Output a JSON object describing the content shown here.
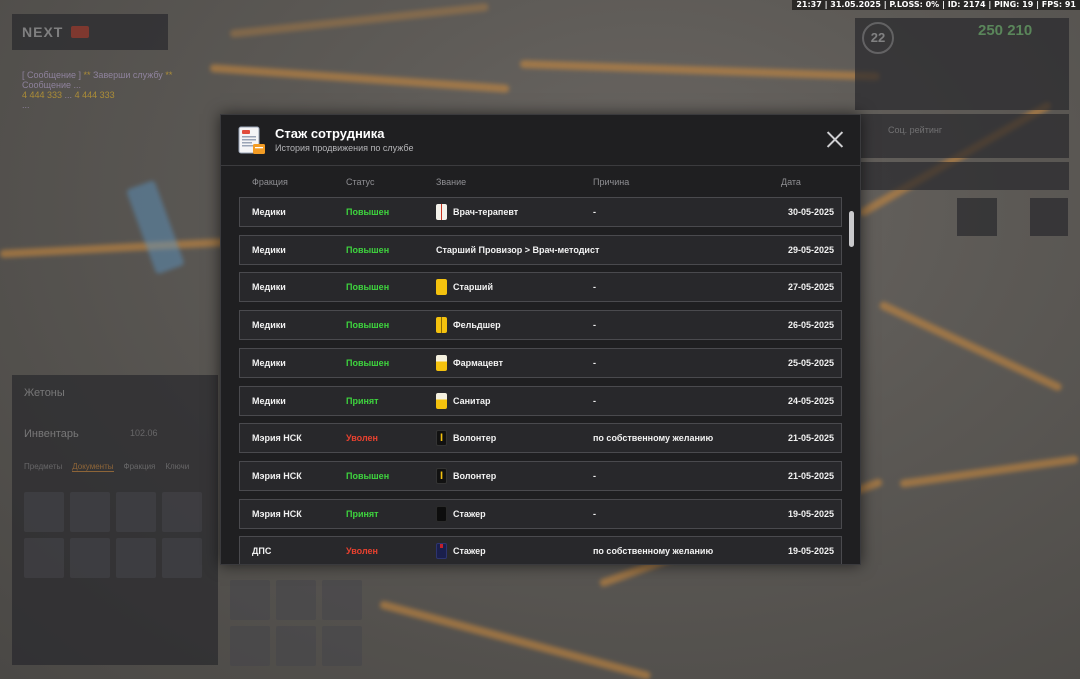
{
  "hud": {
    "time": "21:37",
    "date": "31.05.2025",
    "ploss": "P.LOSS: 0%",
    "id": "ID: 2174",
    "ping": "PING: 19",
    "fps": "FPS: 91"
  },
  "background": {
    "logo": "NEXT",
    "stats_money": "250 210",
    "stats_level": "22",
    "social_label": "Соц. рейтинг",
    "tokens_label": "Жетоны",
    "inventory_label": "Инвентарь",
    "inventory_weight": "102.06",
    "inventory_tabs": [
      "Предметы",
      "Документы",
      "Фракция",
      "Ключи"
    ]
  },
  "modal": {
    "title": "Стаж сотрудника",
    "subtitle": "История продвижения по службе",
    "columns": {
      "faction": "Фракция",
      "status": "Статус",
      "rank": "Звание",
      "reason": "Причина",
      "date": "Дата"
    },
    "rows": [
      {
        "faction": "Медики",
        "status": "Повышен",
        "status_color": "green",
        "badge": "white-stripe",
        "rank": "Врач-терапевт",
        "reason": "-",
        "date": "30-05-2025"
      },
      {
        "faction": "Медики",
        "status": "Повышен",
        "status_color": "green",
        "badge": "none",
        "rank": "Старший Провизор > Врач-методист",
        "reason": "",
        "date": "29-05-2025"
      },
      {
        "faction": "Медики",
        "status": "Повышен",
        "status_color": "green",
        "badge": "yellow",
        "rank": "Старший",
        "reason": "-",
        "date": "27-05-2025"
      },
      {
        "faction": "Медики",
        "status": "Повышен",
        "status_color": "green",
        "badge": "yellow-stripe",
        "rank": "Фельдшер",
        "reason": "-",
        "date": "26-05-2025"
      },
      {
        "faction": "Медики",
        "status": "Повышен",
        "status_color": "green",
        "badge": "half-yellow",
        "rank": "Фармацевт",
        "reason": "-",
        "date": "25-05-2025"
      },
      {
        "faction": "Медики",
        "status": "Принят",
        "status_color": "green",
        "badge": "half-yellow",
        "rank": "Санитар",
        "reason": "-",
        "date": "24-05-2025"
      },
      {
        "faction": "Мэрия НСК",
        "status": "Уволен",
        "status_color": "red",
        "badge": "black-i",
        "rank": "Волонтер",
        "reason": "по собственному желанию",
        "date": "21-05-2025"
      },
      {
        "faction": "Мэрия НСК",
        "status": "Повышен",
        "status_color": "green",
        "badge": "black-i",
        "rank": "Волонтер",
        "reason": "-",
        "date": "21-05-2025"
      },
      {
        "faction": "Мэрия НСК",
        "status": "Принят",
        "status_color": "green",
        "badge": "black",
        "rank": "Стажер",
        "reason": "-",
        "date": "19-05-2025"
      },
      {
        "faction": "ДПС",
        "status": "Уволен",
        "status_color": "red",
        "badge": "navy",
        "rank": "Стажер",
        "reason": "по собственному желанию",
        "date": "19-05-2025"
      }
    ]
  },
  "colors": {
    "modal_bg": "#1f1f21",
    "row_bg": "#28282b",
    "status_green": "#3ed43e",
    "status_red": "#e8412f"
  }
}
